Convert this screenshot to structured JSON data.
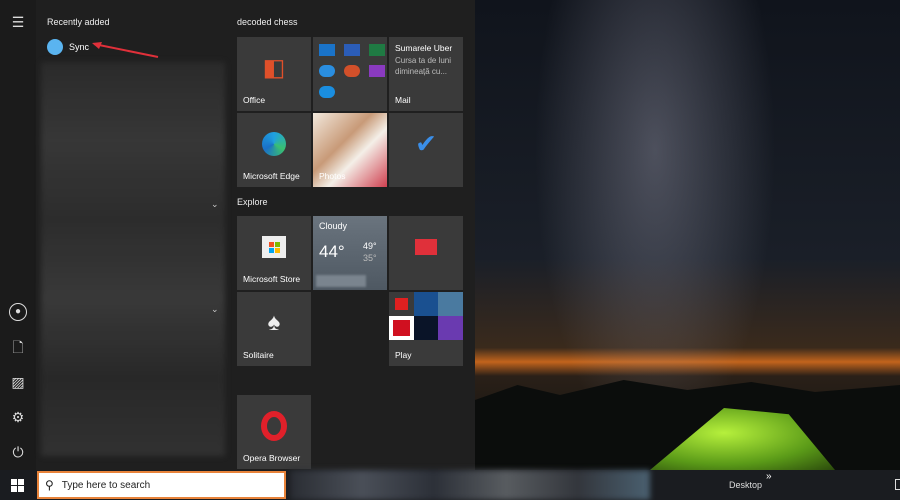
{
  "left": {
    "recently_added": "Recently added",
    "sync": "Sync"
  },
  "groups": {
    "decoded": "decoded chess",
    "explore": "Explore"
  },
  "tiles": {
    "office": "Office",
    "mail": "Mail",
    "mail_title": "Sumarele Uber",
    "mail_body": "Cursa ta de luni dimineață cu...",
    "edge": "Microsoft Edge",
    "photos": "Photos",
    "store": "Microsoft Store",
    "weather_cond": "Cloudy",
    "weather_temp": "44°",
    "weather_hi": "49°",
    "weather_lo": "35°",
    "solitaire": "Solitaire",
    "play": "Play",
    "opera": "Opera Browser"
  },
  "taskbar": {
    "search_placeholder": "Type here to search",
    "desktop": "Desktop",
    "chevrons": "»"
  }
}
